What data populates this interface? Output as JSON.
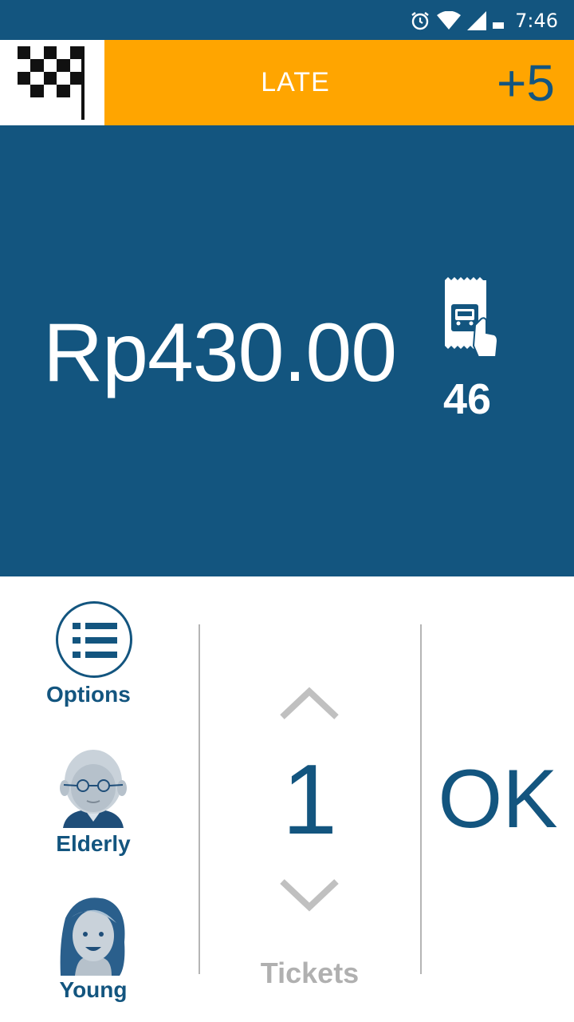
{
  "status_bar": {
    "time": "7:46",
    "icons": [
      "alarm-icon",
      "wifi-icon",
      "cell-signal-icon",
      "battery-icon"
    ]
  },
  "header": {
    "flag_icon": "checkered-flag-icon",
    "title": "LATE",
    "delta": "+5"
  },
  "fare": {
    "amount": "Rp430.00",
    "ticket_icon": "bus-ticket-icon",
    "ticket_count": "46"
  },
  "passenger_types": {
    "options_label": "Options",
    "options_icon": "list-icon",
    "items": [
      {
        "label": "Elderly",
        "icon": "elderly-avatar-icon"
      },
      {
        "label": "Young",
        "icon": "young-avatar-icon"
      }
    ]
  },
  "stepper": {
    "quantity": "1",
    "label": "Tickets",
    "up_icon": "chevron-up-icon",
    "down_icon": "chevron-down-icon"
  },
  "confirm": {
    "label": "OK"
  },
  "colors": {
    "primary": "#13557f",
    "accent": "#ffa500",
    "muted": "#b0b0b0",
    "divider": "#b5b5b5"
  }
}
